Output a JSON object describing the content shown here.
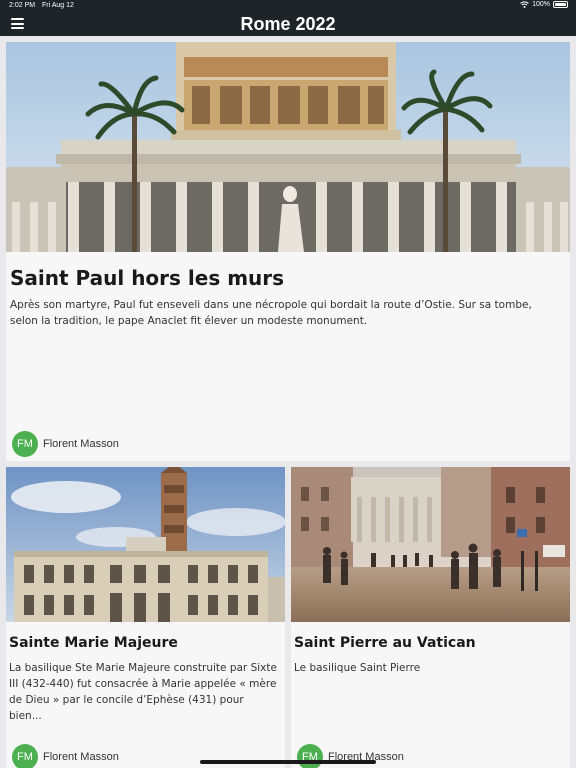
{
  "statusbar": {
    "time": "2:02 PM",
    "date": "Fri Aug 12",
    "battery": "100%",
    "icons": [
      "wifi-icon",
      "battery-icon"
    ]
  },
  "navbar": {
    "title": "Rome 2022",
    "menu_icon": "hamburger-menu-icon"
  },
  "articles": [
    {
      "title": "Saint Paul hors les murs",
      "text": "Après son martyre, Paul fut enseveli dans une nécropole qui bordait la route d’Ostie. Sur sa tombe, selon la tradition, le pape Anaclet fit élever un modeste monument.",
      "author": {
        "initials": "FM",
        "name": "Florent Masson"
      }
    },
    {
      "title": "Sainte Marie Majeure",
      "text": "La basilique Ste Marie Majeure construite par Sixte III (432-440) fut consacrée à Marie appelée « mère de Dieu » par le concile d’Ephèse (431) pour bien...",
      "author": {
        "initials": "FM",
        "name": "Florent Masson"
      }
    },
    {
      "title": "Saint Pierre au Vatican",
      "text": "Le basilique Saint Pierre",
      "author": {
        "initials": "FM",
        "name": "Florent Masson"
      }
    }
  ],
  "colors": {
    "bar": "#1e2428",
    "avatar": "#4caf50",
    "background": "#e9e9eb",
    "card": "#f7f7f8"
  }
}
